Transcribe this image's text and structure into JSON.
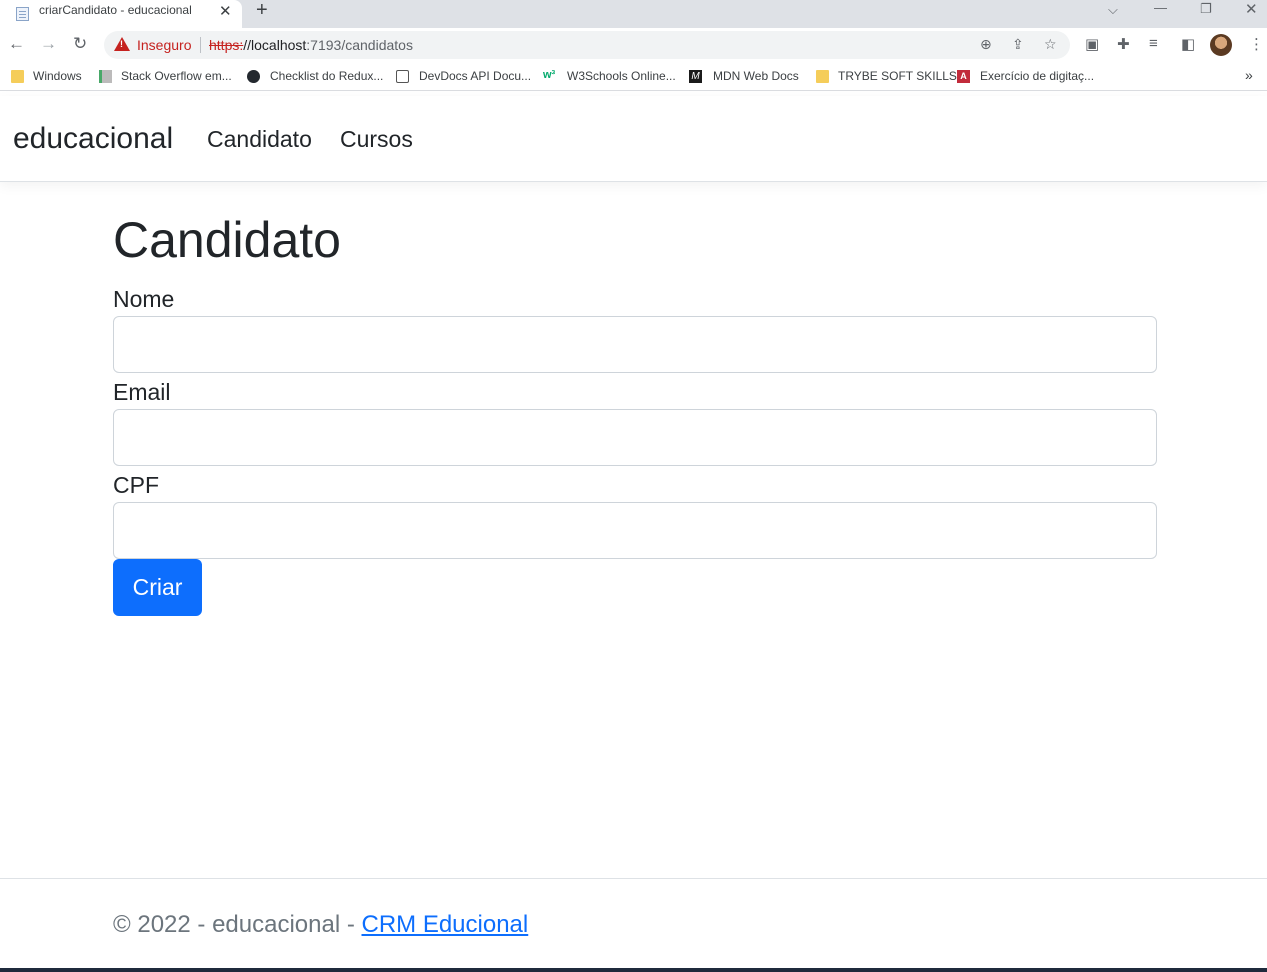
{
  "browser": {
    "tab_title": "criarCandidato - educacional",
    "tab_close": "✕",
    "new_tab": "+",
    "security_label": "Inseguro",
    "url_scheme": "https:",
    "url_host": "//localhost",
    "url_path": ":7193/candidatos",
    "bookmarks": [
      {
        "label": "Windows",
        "icon": "folder-icon"
      },
      {
        "label": "Stack Overflow em...",
        "icon": "stackoverflow-icon"
      },
      {
        "label": "Checklist do Redux...",
        "icon": "github-icon"
      },
      {
        "label": "DevDocs API Docu...",
        "icon": "devdocs-icon"
      },
      {
        "label": "W3Schools Online...",
        "icon": "w3schools-icon"
      },
      {
        "label": "MDN Web Docs",
        "icon": "mdn-icon"
      },
      {
        "label": "TRYBE SOFT SKILLS",
        "icon": "folder-icon"
      },
      {
        "label": "Exercício de digitaç...",
        "icon": "typing-icon"
      }
    ]
  },
  "navbar": {
    "brand": "educacional",
    "links": [
      "Candidato",
      "Cursos"
    ]
  },
  "main": {
    "title": "Candidato",
    "fields": [
      {
        "label": "Nome",
        "value": ""
      },
      {
        "label": "Email",
        "value": ""
      },
      {
        "label": "CPF",
        "value": ""
      }
    ],
    "submit_label": "Criar"
  },
  "footer": {
    "text": "© 2022 - educacional - ",
    "link_text": "CRM Educional"
  },
  "colors": {
    "primary": "#0d6efd",
    "insecure": "#c5221f"
  }
}
